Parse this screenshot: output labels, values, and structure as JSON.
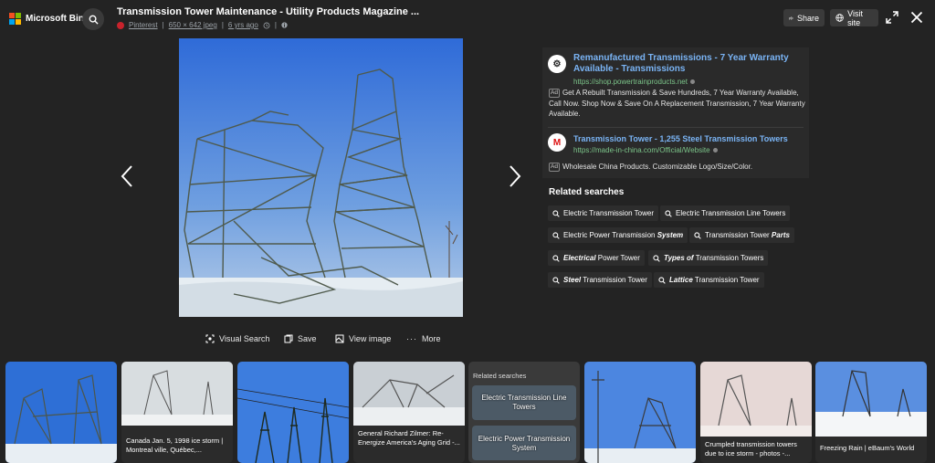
{
  "brand": {
    "name": "Microsoft Bing",
    "colors": [
      "#f25022",
      "#7fba00",
      "#00a4ef",
      "#ffb900"
    ]
  },
  "header": {
    "title": "Transmission Tower Maintenance - Utility Products Magazine ...",
    "source": "Pinterest",
    "dimensions": "650 × 642 jpeg",
    "age": "6 yrs ago",
    "separator": "|",
    "share_label": "Share",
    "visit_label": "Visit site"
  },
  "actions": {
    "visual_search": "Visual Search",
    "save": "Save",
    "view_image": "View image",
    "more": "More"
  },
  "ads": [
    {
      "title": "Remanufactured Transmissions - 7 Year Warranty Available - Transmissions",
      "url": "https://shop.powertrainproducts.net",
      "badge": "Ad",
      "description": "Get A Rebuilt Transmission & Save Hundreds, 7 Year Warranty Available, Call Now. Shop Now & Save On A Replacement Transmission, 7 Year Warranty Available."
    },
    {
      "title": "Transmission Tower - 1,255 Steel Transmission Towers",
      "url": "https://made-in-china.com/Official/Website",
      "badge": "Ad",
      "description": "Wholesale China Products. Customizable Logo/Size/Color."
    }
  ],
  "related": {
    "heading": "Related searches",
    "chips": [
      {
        "pre": "Electric Transmission Tower",
        "bold": "",
        "post": ""
      },
      {
        "pre": "Electric Transmission Line Towers",
        "bold": "",
        "post": ""
      },
      {
        "pre": "Electric Power Transmission ",
        "bold": "System",
        "post": ""
      },
      {
        "pre": "Transmission Tower ",
        "bold": "Parts",
        "post": ""
      },
      {
        "pre": "",
        "bold": "Electrical",
        "post": " Power Tower"
      },
      {
        "pre": "",
        "bold": "Types of",
        "post": " Transmission Towers"
      },
      {
        "pre": "",
        "bold": "Steel",
        "post": " Transmission Tower"
      },
      {
        "pre": "",
        "bold": "Lattice",
        "post": " Transmission Tower"
      }
    ]
  },
  "thumbnails": [
    {
      "caption": ""
    },
    {
      "caption": "Canada Jan. 5, 1998 ice storm | Montreal ville, Québec,..."
    },
    {
      "caption": ""
    },
    {
      "caption": "General Richard Zilmer: Re-Energize America's Aging Grid -..."
    },
    {
      "caption": ""
    },
    {
      "caption": "Crumpled transmission towers due to ice storm - photos -..."
    },
    {
      "caption": "Freezing Rain | eBaum's World"
    }
  ],
  "strip_related": {
    "heading": "Related searches",
    "items": [
      "Electric Transmission Line Towers",
      "Electric Power Transmission System"
    ]
  }
}
